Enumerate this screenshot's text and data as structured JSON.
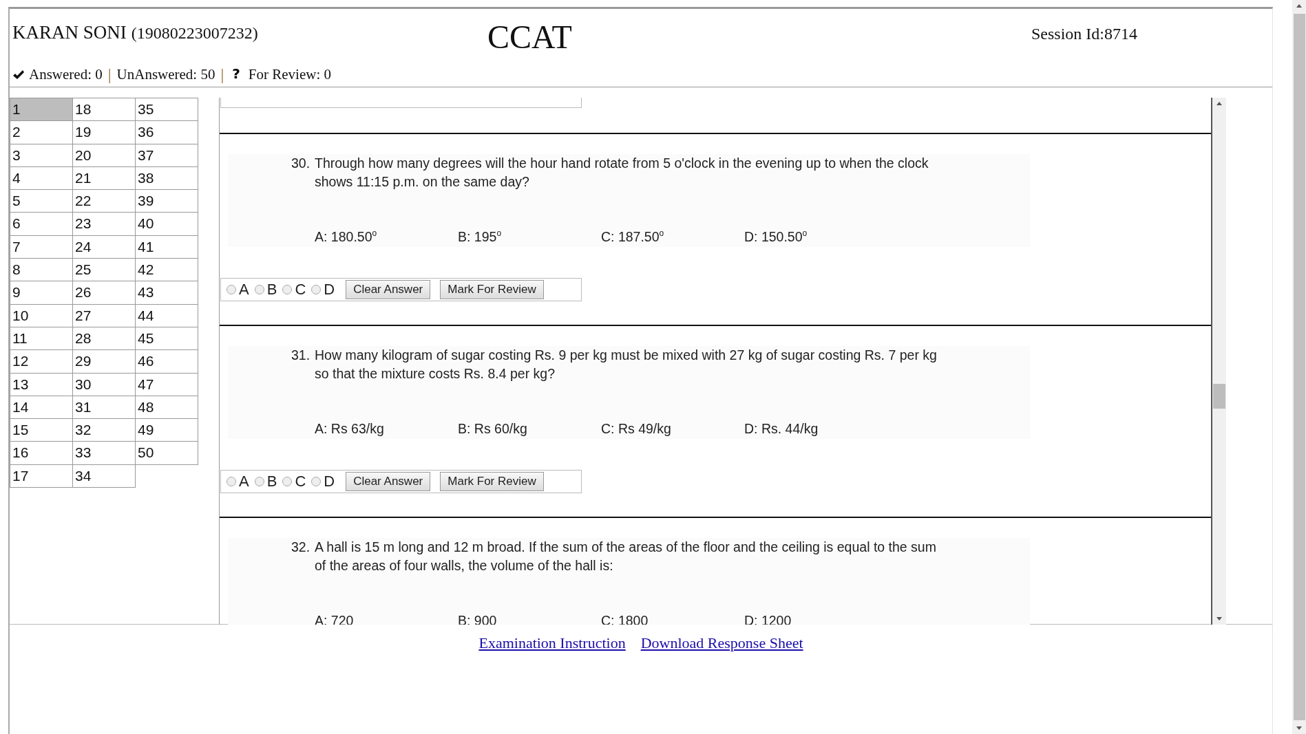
{
  "header": {
    "candidate_name": "KARAN SONI",
    "roll_number": "(19080223007232)",
    "exam_title": "CCAT",
    "session": "Session Id:8714"
  },
  "status": [
    {
      "kind": "check",
      "text": "Answered: 0"
    },
    {
      "kind": "separator",
      "text": "|"
    },
    {
      "kind": "plain",
      "text": "UnAnswered: 50"
    },
    {
      "kind": "separator",
      "text": "|"
    },
    {
      "kind": "question",
      "icon": "?",
      "text": "For Review: 0"
    }
  ],
  "palette": [
    {
      "label": "1",
      "selected": true
    },
    {
      "label": "2",
      "selected": false
    },
    {
      "label": "3",
      "selected": false
    },
    {
      "label": "4",
      "selected": false
    },
    {
      "label": "5",
      "selected": false
    },
    {
      "label": "6",
      "selected": false
    },
    {
      "label": "7",
      "selected": false
    },
    {
      "label": "8",
      "selected": false
    },
    {
      "label": "9",
      "selected": false
    },
    {
      "label": "10",
      "selected": false
    },
    {
      "label": "11",
      "selected": false
    },
    {
      "label": "12",
      "selected": false
    },
    {
      "label": "13",
      "selected": false
    },
    {
      "label": "14",
      "selected": false
    },
    {
      "label": "15",
      "selected": false
    },
    {
      "label": "16",
      "selected": false
    },
    {
      "label": "17",
      "selected": false
    },
    {
      "label": "18",
      "selected": false
    },
    {
      "label": "19",
      "selected": false
    },
    {
      "label": "20",
      "selected": false
    },
    {
      "label": "21",
      "selected": false
    },
    {
      "label": "22",
      "selected": false
    },
    {
      "label": "23",
      "selected": false
    },
    {
      "label": "24",
      "selected": false
    },
    {
      "label": "25",
      "selected": false
    },
    {
      "label": "26",
      "selected": false
    },
    {
      "label": "27",
      "selected": false
    },
    {
      "label": "28",
      "selected": false
    },
    {
      "label": "29",
      "selected": false
    },
    {
      "label": "30",
      "selected": false
    },
    {
      "label": "31",
      "selected": false
    },
    {
      "label": "32",
      "selected": false
    },
    {
      "label": "33",
      "selected": false
    },
    {
      "label": "34",
      "selected": false
    },
    {
      "label": "35",
      "selected": false
    },
    {
      "label": "36",
      "selected": false
    },
    {
      "label": "37",
      "selected": false
    },
    {
      "label": "38",
      "selected": false
    },
    {
      "label": "39",
      "selected": false
    },
    {
      "label": "40",
      "selected": false
    },
    {
      "label": "41",
      "selected": false
    },
    {
      "label": "42",
      "selected": false
    },
    {
      "label": "43",
      "selected": false
    },
    {
      "label": "44",
      "selected": false
    },
    {
      "label": "45",
      "selected": false
    },
    {
      "label": "46",
      "selected": false
    },
    {
      "label": "47",
      "selected": false
    },
    {
      "label": "48",
      "selected": false
    },
    {
      "label": "49",
      "selected": false
    },
    {
      "label": "50",
      "selected": false
    }
  ],
  "questions": [
    {
      "number": "30.",
      "text": "Through how many degrees will the hour hand rotate from 5 o'clock in the evening up to when the clock shows 11:15 p.m. on the same day?",
      "options": [
        "A: 180.50$^{o}$",
        "B: 195$^{o}$",
        "C: 187.50$^{o}$",
        "D: 150.50$^{o}$"
      ],
      "answers": [
        {
          "label": "A",
          "selected": false
        },
        {
          "label": "B",
          "selected": false
        },
        {
          "label": "C",
          "selected": false
        },
        {
          "label": "D",
          "selected": false
        }
      ],
      "buttons": [
        "Clear Answer",
        "Mark For Review"
      ]
    },
    {
      "number": "31.",
      "text": "How many kilogram of sugar costing Rs. 9 per kg must be mixed with 27 kg of sugar costing Rs. 7 per kg so that the mixture costs Rs. 8.4 per kg?",
      "options": [
        "A: Rs 63/kg",
        "B: Rs 60/kg",
        "C: Rs 49/kg",
        "D: Rs. 44/kg"
      ],
      "answers": [
        {
          "label": "A",
          "selected": false
        },
        {
          "label": "B",
          "selected": false
        },
        {
          "label": "C",
          "selected": false
        },
        {
          "label": "D",
          "selected": false
        }
      ],
      "buttons": [
        "Clear Answer",
        "Mark For Review"
      ]
    },
    {
      "number": "32.",
      "text": "A hall is 15 m long and 12 m broad. If the sum of the areas of the floor and the ceiling is equal to the sum of the areas of four walls, the volume of the hall is:",
      "options": [
        "A: 720",
        "B: 900",
        "C: 1800",
        "D: 1200"
      ]
    }
  ],
  "footer_links": [
    "Examination Instruction",
    "Download Response Sheet"
  ]
}
